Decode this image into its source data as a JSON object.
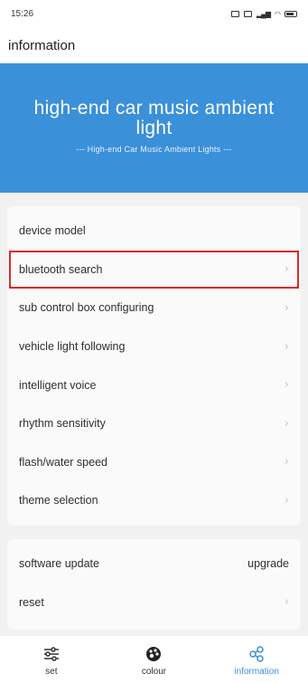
{
  "status": {
    "time": "15:26"
  },
  "header": {
    "title": "information"
  },
  "banner": {
    "title": "high-end car music ambient light",
    "subtitle": "--- High-end Car Music Ambient Lights ---"
  },
  "settings": {
    "items": [
      {
        "label": "device model"
      },
      {
        "label": "bluetooth search"
      },
      {
        "label": "sub control box configuring"
      },
      {
        "label": "vehicle light following"
      },
      {
        "label": "intelligent voice"
      },
      {
        "label": "rhythm sensitivity"
      },
      {
        "label": "flash/water speed"
      },
      {
        "label": "theme selection"
      }
    ]
  },
  "system": {
    "software_update": {
      "label": "software update",
      "value": "upgrade"
    },
    "reset": {
      "label": "reset"
    }
  },
  "tabs": [
    {
      "label": "set",
      "icon": "sliders-icon",
      "active": false
    },
    {
      "label": "colour",
      "icon": "palette-icon",
      "active": false
    },
    {
      "label": "information",
      "icon": "share-icon",
      "active": true
    }
  ],
  "colors": {
    "accent": "#3a90d9",
    "highlight": "#d92a2a",
    "background": "#f1f1f1"
  }
}
